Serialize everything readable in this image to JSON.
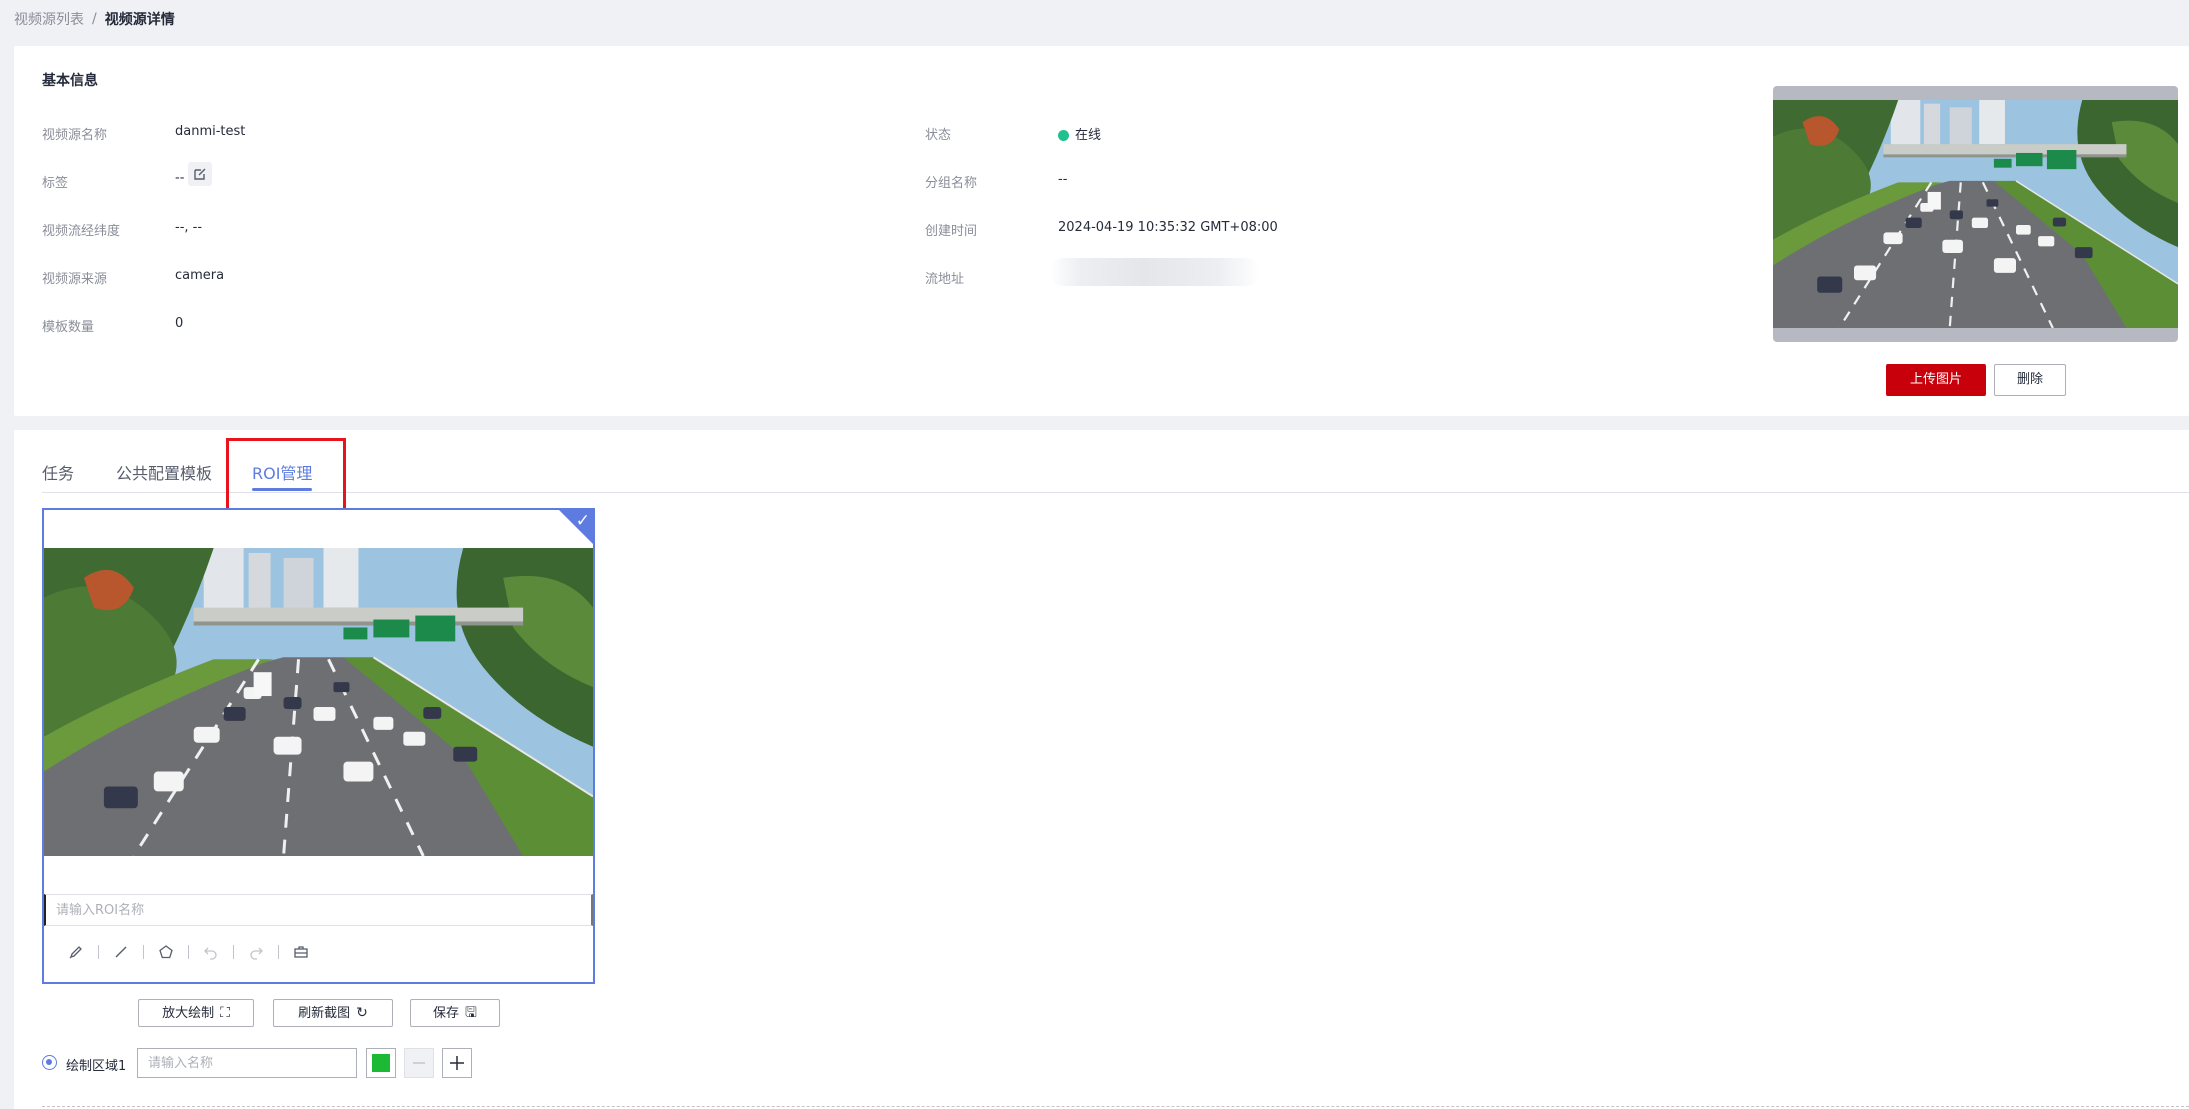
{
  "breadcrumb": {
    "parent": "视频源列表",
    "separator": "/",
    "current": "视频源详情"
  },
  "basic_info": {
    "title": "基本信息",
    "name_label": "视频源名称",
    "name_value": "danmi-test",
    "tag_label": "标签",
    "tag_value": "--",
    "coords_label": "视频流经纬度",
    "coords_value": "--, --",
    "source_label": "视频源来源",
    "source_value": "camera",
    "template_count_label": "模板数量",
    "template_count_value": "0",
    "status_label": "状态",
    "status_value": "在线",
    "group_label": "分组名称",
    "group_value": "--",
    "created_label": "创建时间",
    "created_value": "2024-04-19 10:35:32 GMT+08:00",
    "stream_label": "流地址"
  },
  "thumbnail": {
    "upload_label": "上传图片",
    "delete_label": "删除"
  },
  "tabs": [
    {
      "label": "任务"
    },
    {
      "label": "公共配置模板"
    },
    {
      "label": "ROI管理"
    }
  ],
  "active_tab": "ROI管理",
  "roi": {
    "name_placeholder": "请输入ROI名称",
    "tools": [
      "pen-icon",
      "line-icon",
      "polygon-icon",
      "undo-icon",
      "redo-icon",
      "toolbox-icon"
    ],
    "enlarge_label": "放大绘制",
    "refresh_label": "刷新截图",
    "save_label": "保存",
    "region_label": "绘制区域1",
    "region_placeholder": "请输入名称",
    "region_color": "#1bb934"
  },
  "colors": {
    "accent": "#5e7ce0",
    "danger": "#c7000b",
    "online": "#1fc28e",
    "highlight": "#e8141d"
  }
}
